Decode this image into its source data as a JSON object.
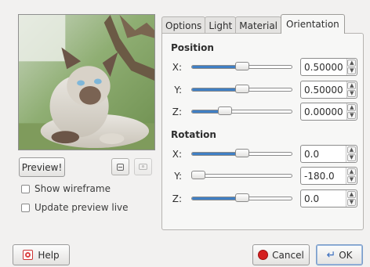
{
  "preview": {
    "image_alt": "Siamese cat lying on grass",
    "button_label": "Preview!"
  },
  "options": {
    "show_wireframe": {
      "label": "Show wireframe",
      "checked": false
    },
    "update_preview_live": {
      "label": "Update preview live",
      "checked": false
    }
  },
  "tabs": [
    {
      "label": "Options",
      "active": false
    },
    {
      "label": "Light",
      "active": false
    },
    {
      "label": "Material",
      "active": false
    },
    {
      "label": "Orientation",
      "active": true
    }
  ],
  "position": {
    "title": "Position",
    "rows": [
      {
        "axis": "X:",
        "value": "0.50000",
        "fill": 0.5
      },
      {
        "axis": "Y:",
        "value": "0.50000",
        "fill": 0.5
      },
      {
        "axis": "Z:",
        "value": "0.00000",
        "fill": 0.33
      }
    ]
  },
  "rotation": {
    "title": "Rotation",
    "rows": [
      {
        "axis": "X:",
        "value": "0.0",
        "fill": 0.5
      },
      {
        "axis": "Y:",
        "value": "-180.0",
        "fill": 0.0
      },
      {
        "axis": "Z:",
        "value": "0.0",
        "fill": 0.5
      }
    ]
  },
  "footer": {
    "help_label": "Help",
    "cancel_label": "Cancel",
    "ok_label": "OK"
  },
  "colors": {
    "slider_fill": "#3f7fc4",
    "cancel_icon": "#d42020",
    "ok_icon": "#3b6fbf"
  }
}
